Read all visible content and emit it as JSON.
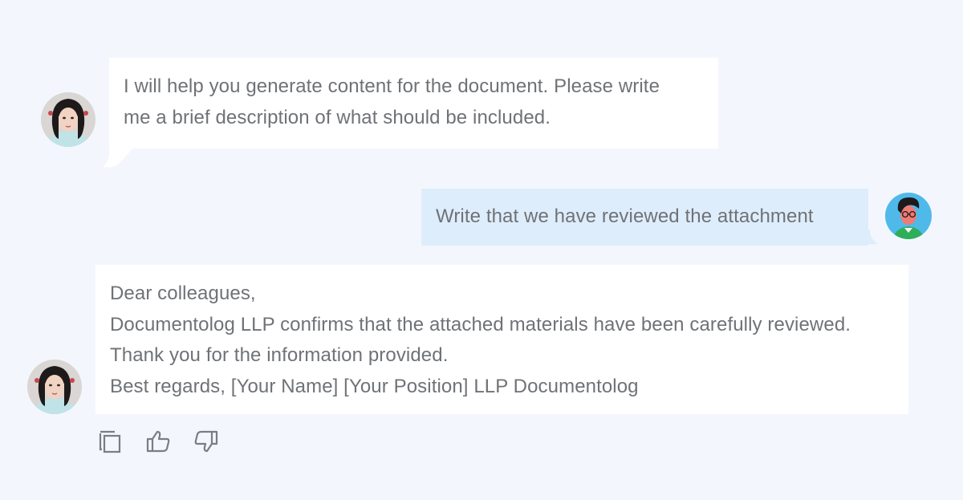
{
  "messages": [
    {
      "role": "assistant",
      "lines": [
        "I will help you generate content for the document. Please write",
        "me a brief description of what should be included."
      ]
    },
    {
      "role": "user",
      "lines": [
        "Write that we have reviewed the attachment"
      ]
    },
    {
      "role": "assistant",
      "lines": [
        "Dear colleagues,",
        "Documentolog LLP confirms that the attached materials have been carefully reviewed.",
        "Thank you for the information provided.",
        "Best regards, [Your Name] [Your Position] LLP Documentolog"
      ]
    }
  ],
  "actions": {
    "copy_icon": "copy-icon",
    "like_icon": "thumbs-up-icon",
    "dislike_icon": "thumbs-down-icon"
  },
  "colors": {
    "background": "#f3f7fd",
    "assistant_bubble": "#ffffff",
    "user_bubble": "#deedfc",
    "text": "#6f7276",
    "icon": "#7a7d82"
  }
}
